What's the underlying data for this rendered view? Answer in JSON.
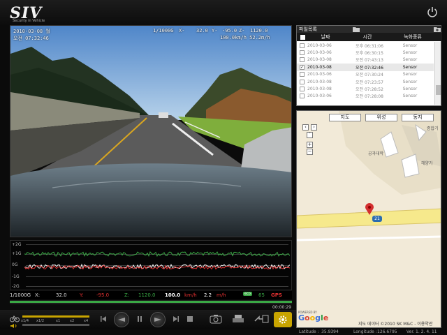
{
  "app": {
    "logo": "SIV",
    "tagline": "Security in Vehicle"
  },
  "colors": {
    "accent_green": "#3aa845",
    "accent_red": "#e03030",
    "accent_yellow": "#c8a400",
    "selected_row": "#e8e8e8"
  },
  "osd": {
    "date": "2010-03-08 월",
    "time": "오전 07:32:46",
    "scale": "1/1000G",
    "x_readout": "X-",
    "x_value": "32.0",
    "y_readout": "Y-",
    "y_value": "-95.0",
    "z_readout": "Z-",
    "z_value": "1120.0",
    "speed": "100.0km/h 52.2m/h"
  },
  "graph": {
    "labels": [
      "+2G",
      "+1G",
      "0G",
      "-1G",
      "-2G"
    ],
    "progress_fraction": 1.0
  },
  "telemetry": {
    "scale": "1/1000G",
    "x_label": "X:",
    "x_value": "32.0",
    "y_label": "Y:",
    "y_value": "-95.0",
    "z_label": "Z:",
    "z_value": "1120.0",
    "speed_value": "100.0",
    "speed_unit": "km/h",
    "dist_value": "2.2",
    "dist_unit": "m/h",
    "eco_badge": "eco",
    "eco_value": "65",
    "gps_badge": "GPS"
  },
  "playback": {
    "elapsed": "00:00:29",
    "speed_marks": [
      "x1/4",
      "x1/2",
      "x1",
      "x2",
      "x4"
    ]
  },
  "recordings": {
    "title": "파일목록",
    "columns": [
      "날짜",
      "시간",
      "녹화종류"
    ],
    "rows": [
      {
        "date": "2010-03-06",
        "time": "오후 06:31:06",
        "type": "Sensor",
        "checked": false,
        "selected": false
      },
      {
        "date": "2010-03-06",
        "time": "오후 06:30:15",
        "type": "Sensor",
        "checked": false,
        "selected": false
      },
      {
        "date": "2010-03-08",
        "time": "오전 07:43:13",
        "type": "Sensor",
        "checked": false,
        "selected": false
      },
      {
        "date": "2010-03-08",
        "time": "오전 07:32:46",
        "type": "Sensor",
        "checked": true,
        "selected": true
      },
      {
        "date": "2010-03-06",
        "time": "오전 07:30:24",
        "type": "Sensor",
        "checked": false,
        "selected": false
      },
      {
        "date": "2010-03-08",
        "time": "오전 07:23:57",
        "type": "Sensor",
        "checked": false,
        "selected": false
      },
      {
        "date": "2010-03-08",
        "time": "오전 07:28:52",
        "type": "Sensor",
        "checked": false,
        "selected": false
      },
      {
        "date": "2010-03-06",
        "time": "오전 07:28:08",
        "type": "Sensor",
        "checked": false,
        "selected": false
      }
    ]
  },
  "map": {
    "tabs": [
      "지도",
      "위성",
      "동지"
    ],
    "labels": {
      "college": "공과대학",
      "area_ne": "종합기",
      "area_e": "해양가",
      "route": "21"
    },
    "google_logo": "Google",
    "powered_by": "POWERED BY",
    "copyright": "지도 데이터 ©2010 SK M&C - 이용약관"
  },
  "status": {
    "latitude_label": "Latitude :",
    "latitude": "35.9394",
    "longitude_label": "Longitude :",
    "longitude": "126.6795",
    "version": "Ver. 1. 2. 4. 11"
  }
}
